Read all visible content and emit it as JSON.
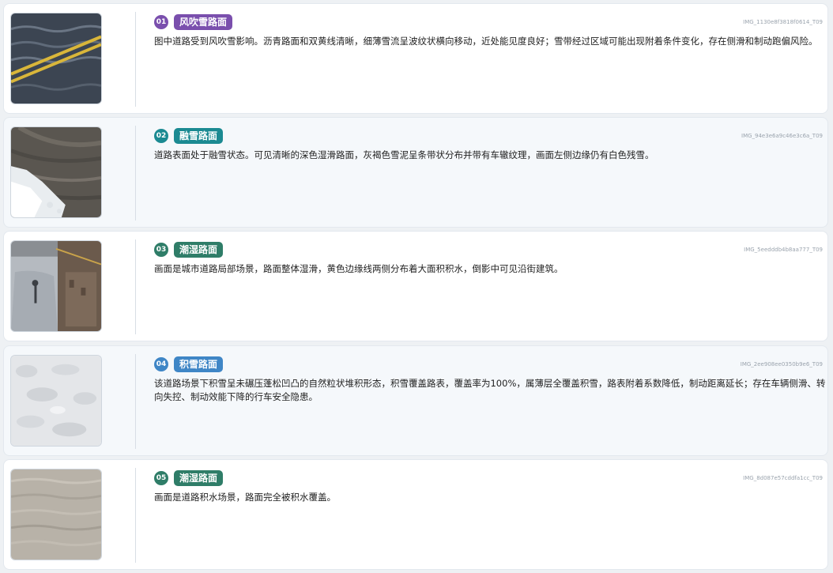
{
  "colors": {
    "purple": "#7a4fad",
    "teal": "#1b8a92",
    "green": "#2f7d68",
    "blue": "#3f86c6"
  },
  "items": [
    {
      "num": "01",
      "tag": "风吹雪路面",
      "tag_color": "#7a4fad",
      "image_id": "IMG_1130e8f3818f0614_T09",
      "thumb_icon": "windblown-snow-road-photo",
      "description": "图中道路受到风吹雪影响。沥青路面和双黄线清晰，细薄雪流呈波纹状横向移动，近处能见度良好；雪带经过区域可能出现附着条件变化，存在侧滑和制动跑偏风险。"
    },
    {
      "num": "02",
      "tag": "融雪路面",
      "tag_color": "#1b8a92",
      "image_id": "IMG_94e3e6a9c46e3c6a_T09",
      "thumb_icon": "melting-snow-road-photo",
      "description": "道路表面处于融雪状态。可见清晰的深色湿滑路面，灰褐色雪泥呈条带状分布并带有车辙纹理，画面左侧边缘仍有白色残雪。"
    },
    {
      "num": "03",
      "tag": "潮湿路面",
      "tag_color": "#2f7d68",
      "image_id": "IMG_5eedddb4b8aa777_T09",
      "thumb_icon": "wet-road-photo",
      "description": "画面是城市道路局部场景，路面整体湿滑，黄色边缘线两侧分布着大面积积水，倒影中可见沿街建筑。"
    },
    {
      "num": "04",
      "tag": "积雪路面",
      "tag_color": "#3f86c6",
      "image_id": "IMG_2ee908ee0350b9e6_T09",
      "thumb_icon": "snow-covered-road-photo",
      "description": "该道路场景下积雪呈未碾压蓬松凹凸的自然粒状堆积形态，积雪覆盖路表，覆盖率为100%，属薄层全覆盖积雪，路表附着系数降低，制动距离延长；存在车辆侧滑、转向失控、制动效能下降的行车安全隐患。"
    },
    {
      "num": "05",
      "tag": "潮湿路面",
      "tag_color": "#2f7d68",
      "image_id": "IMG_8d087e57cddfa1cc_T09",
      "thumb_icon": "waterlogged-road-photo",
      "description": "画面是道路积水场景，路面完全被积水覆盖。"
    }
  ]
}
